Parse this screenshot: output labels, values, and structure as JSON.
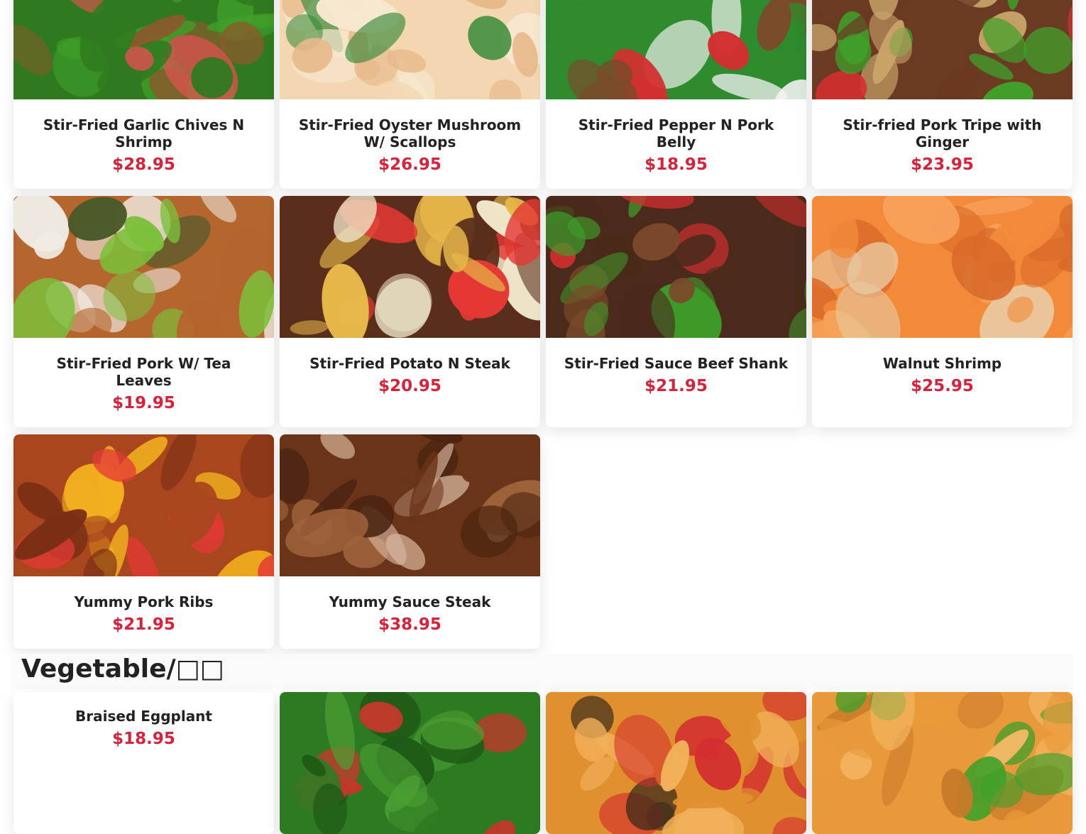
{
  "colors": {
    "price": "#d6223a",
    "title": "#222222"
  },
  "menu_rows": [
    [
      {
        "name": "Stir-Fried Garlic Chives N Shrimp",
        "price": "$28.95",
        "img": "garlic-chives-shrimp",
        "palette": [
          "#2f7a1e",
          "#3fa02a",
          "#d9534f",
          "#8a5a2b"
        ]
      },
      {
        "name": "Stir-Fried Oyster Mushroom W/ Scallops",
        "price": "$26.95",
        "img": "oyster-mushroom-scallops",
        "palette": [
          "#f2d7b0",
          "#e7b98a",
          "#f7e8d0",
          "#3a8a3a"
        ]
      },
      {
        "name": "Stir-Fried Pepper N Pork Belly",
        "price": "$18.95",
        "img": "pepper-pork-belly",
        "palette": [
          "#2e8b2e",
          "#7a4b2a",
          "#d32f2f",
          "#f5f5f5"
        ]
      },
      {
        "name": "Stir-fried Pork Tripe with Ginger",
        "price": "$23.95",
        "img": "pork-tripe-ginger",
        "palette": [
          "#6b3a22",
          "#d32f2f",
          "#3fa02a",
          "#c9a46a"
        ]
      }
    ],
    [
      {
        "name": "Stir-Fried Pork W/ Tea Leaves",
        "price": "$19.95",
        "img": "pork-tea-leaves",
        "palette": [
          "#b5652e",
          "#7cbf3a",
          "#4a5a2a",
          "#f0ece4"
        ]
      },
      {
        "name": "Stir-Fried Potato N Steak",
        "price": "$20.95",
        "img": "potato-steak",
        "palette": [
          "#5a2e1a",
          "#e6b84a",
          "#e53935",
          "#efe6c8"
        ]
      },
      {
        "name": "Stir-Fried Sauce Beef Shank",
        "price": "$21.95",
        "img": "sauce-beef-shank",
        "palette": [
          "#4a2a1a",
          "#3f9a2a",
          "#d32f2f",
          "#7a4a2a"
        ]
      },
      {
        "name": "Walnut Shrimp",
        "price": "$25.95",
        "img": "walnut-shrimp",
        "palette": [
          "#f28a3a",
          "#f7a25a",
          "#e9c9a0",
          "#d96a2a"
        ]
      }
    ],
    [
      {
        "name": "Yummy Pork Ribs",
        "price": "$21.95",
        "img": "pork-ribs",
        "palette": [
          "#a8461e",
          "#e53935",
          "#f2b01e",
          "#7a2e14"
        ]
      },
      {
        "name": "Yummy Sauce Steak",
        "price": "$38.95",
        "img": "sauce-steak",
        "palette": [
          "#6a3418",
          "#a0643c",
          "#d9b8a0",
          "#4a2410"
        ]
      }
    ]
  ],
  "vegetable_section": {
    "title": "Vegetable/□□",
    "items": [
      {
        "name": "Braised Eggplant",
        "price": "$18.95",
        "img": null,
        "palette": []
      },
      {
        "name": "",
        "price": "",
        "img": "green-beans",
        "palette": [
          "#2e7a22",
          "#4aa032",
          "#c0392b",
          "#1e5a16"
        ]
      },
      {
        "name": "",
        "price": "",
        "img": "braised-tofu",
        "palette": [
          "#e0902e",
          "#f2b05a",
          "#d32f2f",
          "#3a2a1a"
        ]
      },
      {
        "name": "",
        "price": "",
        "img": "home-style-tofu",
        "palette": [
          "#e89a3a",
          "#f5b866",
          "#3fa02a",
          "#c97a2a"
        ]
      }
    ]
  }
}
